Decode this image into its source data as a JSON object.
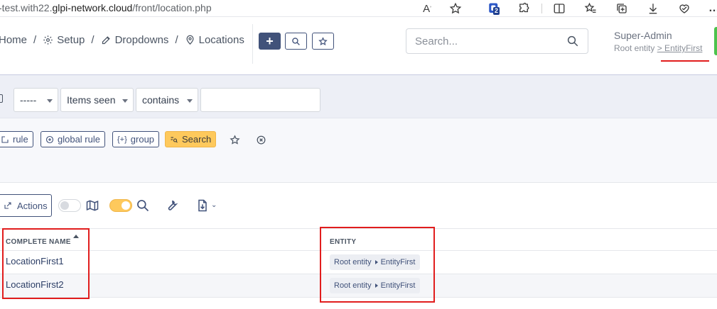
{
  "browser": {
    "url_prefix": "-test.with22.",
    "url_host": "glpi-network.cloud",
    "url_path": "/front/location.php",
    "extension_badge": "2"
  },
  "header": {
    "breadcrumbs": [
      {
        "label": "Home",
        "icon": "home-icon"
      },
      {
        "label": "Setup",
        "icon": "gear-icon"
      },
      {
        "label": "Dropdowns",
        "icon": "edit-icon"
      },
      {
        "label": "Locations",
        "icon": "map-pin-icon"
      }
    ],
    "add_label": "+",
    "search_placeholder": "Search...",
    "user_name": "Super-Admin",
    "entity_prefix": "Root entity",
    "entity_current": "> EntityFirst"
  },
  "criteria": {
    "field_select": "-----",
    "field_items": "Items seen",
    "operator": "contains",
    "value": ""
  },
  "criteria_buttons": {
    "rule": "rule",
    "global_rule": "global rule",
    "group": "group",
    "search": "Search"
  },
  "toolbar": {
    "actions": "Actions"
  },
  "table": {
    "columns": [
      "COMPLETE NAME",
      "ENTITY"
    ],
    "rows": [
      {
        "name": "LocationFirst1",
        "entity_root": "Root entity",
        "entity_child": "EntityFirst"
      },
      {
        "name": "LocationFirst2",
        "entity_root": "Root entity",
        "entity_child": "EntityFirst"
      }
    ]
  },
  "colors": {
    "primary": "#41527a",
    "accent": "#fec95c",
    "highlight": "#e11d1d"
  }
}
